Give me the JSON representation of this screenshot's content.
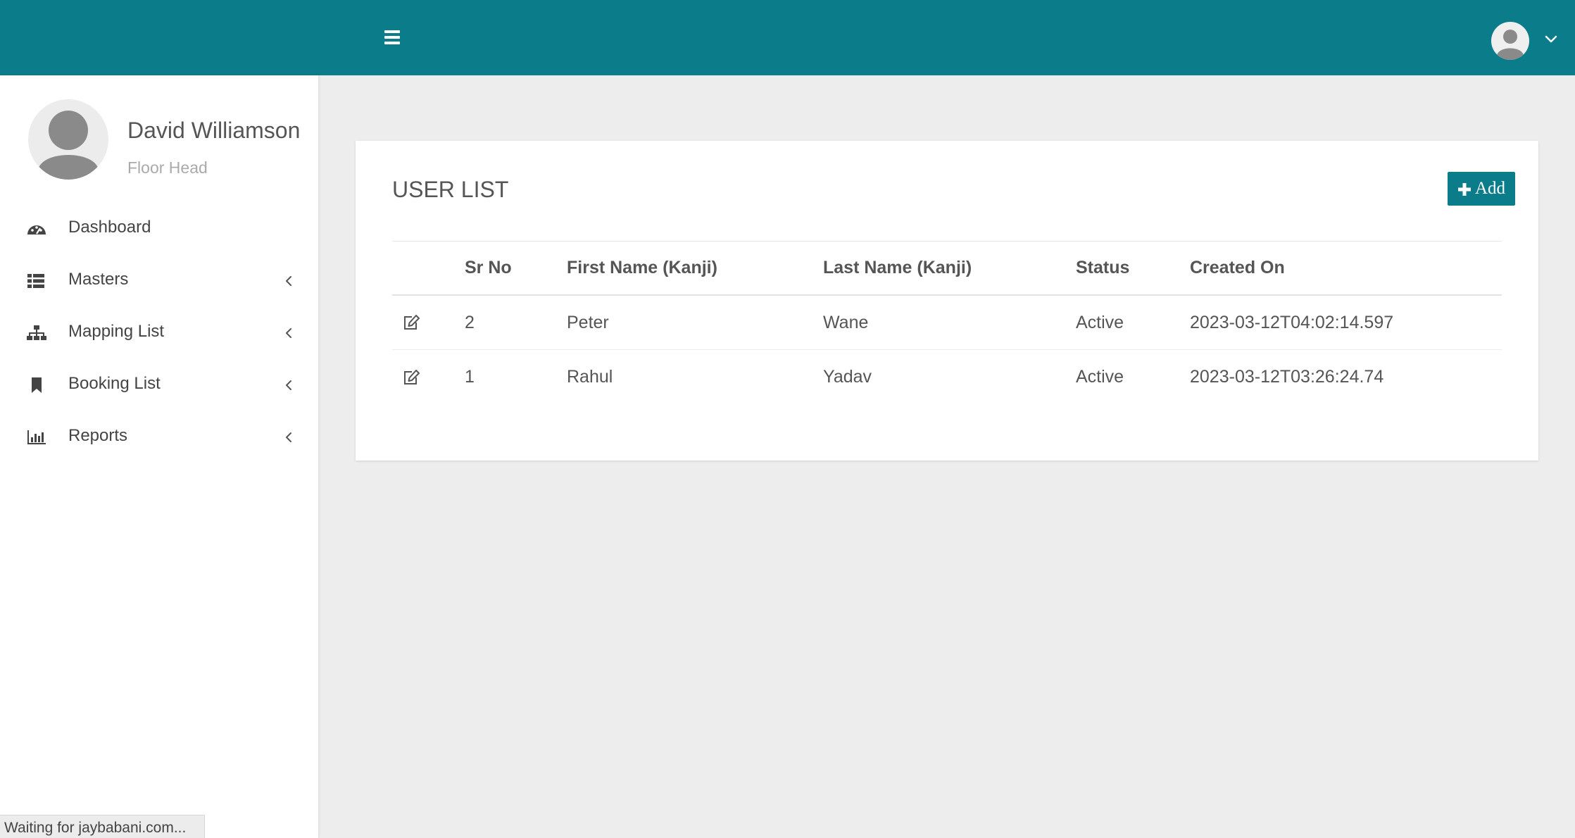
{
  "header": {
    "menu_icon": "hamburger-icon",
    "user_icon": "user-avatar-icon",
    "dropdown_icon": "chevron-down-icon"
  },
  "profile": {
    "name": "David Williamson",
    "role": "Floor Head"
  },
  "sidebar": {
    "items": [
      {
        "label": "Dashboard",
        "icon": "dashboard-icon",
        "has_submenu": false
      },
      {
        "label": "Masters",
        "icon": "list-icon",
        "has_submenu": true
      },
      {
        "label": "Mapping List",
        "icon": "sitemap-icon",
        "has_submenu": true
      },
      {
        "label": "Booking List",
        "icon": "bookmark-icon",
        "has_submenu": true
      },
      {
        "label": "Reports",
        "icon": "bar-chart-icon",
        "has_submenu": true
      }
    ]
  },
  "card": {
    "title": "USER LIST",
    "add_label": "Add"
  },
  "table": {
    "columns": [
      "",
      "Sr No",
      "First Name (Kanji)",
      "Last Name (Kanji)",
      "Status",
      "Created On"
    ],
    "rows": [
      {
        "sr_no": "2",
        "first_name": "Peter",
        "last_name": "Wane",
        "status": "Active",
        "created_on": "2023-03-12T04:02:14.597"
      },
      {
        "sr_no": "1",
        "first_name": "Rahul",
        "last_name": "Yadav",
        "status": "Active",
        "created_on": "2023-03-12T03:26:24.74"
      }
    ]
  },
  "status_bar": {
    "text": "Waiting for jaybabani.com..."
  },
  "colors": {
    "primary": "#0b7c8a",
    "background": "#ededed"
  }
}
